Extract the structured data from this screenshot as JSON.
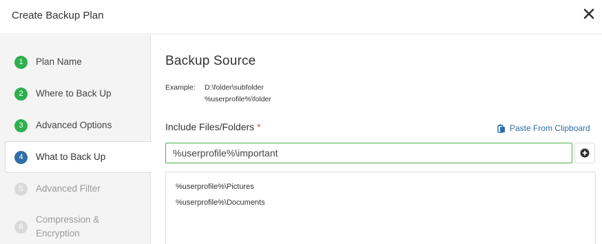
{
  "dialog": {
    "title": "Create Backup Plan",
    "close_icon": "close-icon"
  },
  "steps": [
    {
      "number": "1",
      "label": "Plan Name",
      "state": "done"
    },
    {
      "number": "2",
      "label": "Where to Back Up",
      "state": "done"
    },
    {
      "number": "3",
      "label": "Advanced Options",
      "state": "done"
    },
    {
      "number": "4",
      "label": "What to Back Up",
      "state": "active"
    },
    {
      "number": "5",
      "label": "Advanced Filter",
      "state": "pending"
    },
    {
      "number": "6",
      "label": "Compression &",
      "label2": "Encryption",
      "state": "pending"
    }
  ],
  "main": {
    "title": "Backup Source",
    "example_label": "Example:",
    "example_lines": [
      "D:\\folder\\subfolder",
      "%userprofile%\\folder"
    ],
    "include_label": "Include Files/Folders",
    "required_mark": "*",
    "paste_label": "Paste From Clipboard",
    "paste_icon": "clipboard-icon",
    "input_value": "%userprofile%\\important",
    "add_icon": "plus-circle-icon",
    "items": [
      "%userprofile%\\Pictures",
      "%userprofile%\\Documents"
    ]
  },
  "colors": {
    "done": "#2eb04d",
    "active": "#2f6ea6",
    "pending": "#d9d9d9",
    "link": "#2f6ea6",
    "required": "#d9534f",
    "input_border": "#4cae4c"
  }
}
